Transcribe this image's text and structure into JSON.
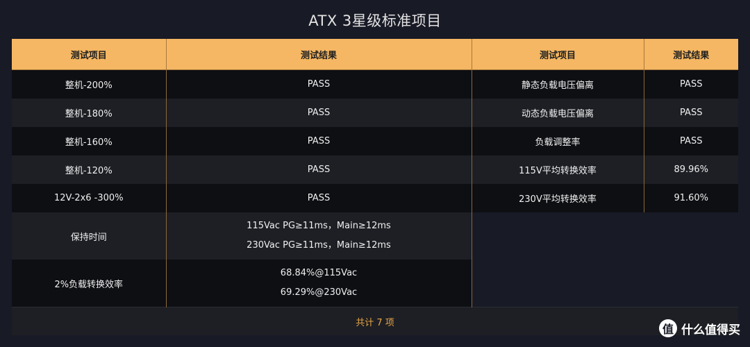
{
  "title": "ATX 3星级标准项目",
  "table": {
    "headers": [
      "测试项目",
      "测试结果",
      "测试项目",
      "测试结果"
    ],
    "rows": [
      {
        "item": "整机-200%",
        "result": "PASS",
        "item2": "静态负载电压偏离",
        "result2": "PASS"
      },
      {
        "item": "整机-180%",
        "result": "PASS",
        "item2": "动态负载电压偏离",
        "result2": "PASS"
      },
      {
        "item": "整机-160%",
        "result": "PASS",
        "item2": "负载调整率",
        "result2": "PASS"
      },
      {
        "item": "整机-120%",
        "result": "PASS",
        "item2": "115V平均转换效率",
        "result2": "89.96%"
      },
      {
        "item": "12V-2x6 -300%",
        "result": "PASS",
        "item2": "230V平均转换效率",
        "result2": "91.60%"
      }
    ],
    "extra_rows": [
      {
        "item": "保持时间",
        "lines": [
          "115Vac PG≥11ms，Main≥12ms",
          "230Vac PG≥11ms，Main≥12ms"
        ]
      },
      {
        "item": "2%负载转换效率",
        "lines": [
          "68.84%@115Vac",
          "69.29%@230Vac"
        ]
      }
    ],
    "footer": "共计 7 项"
  },
  "watermark": {
    "icon": "值",
    "text": "什么值得买"
  }
}
